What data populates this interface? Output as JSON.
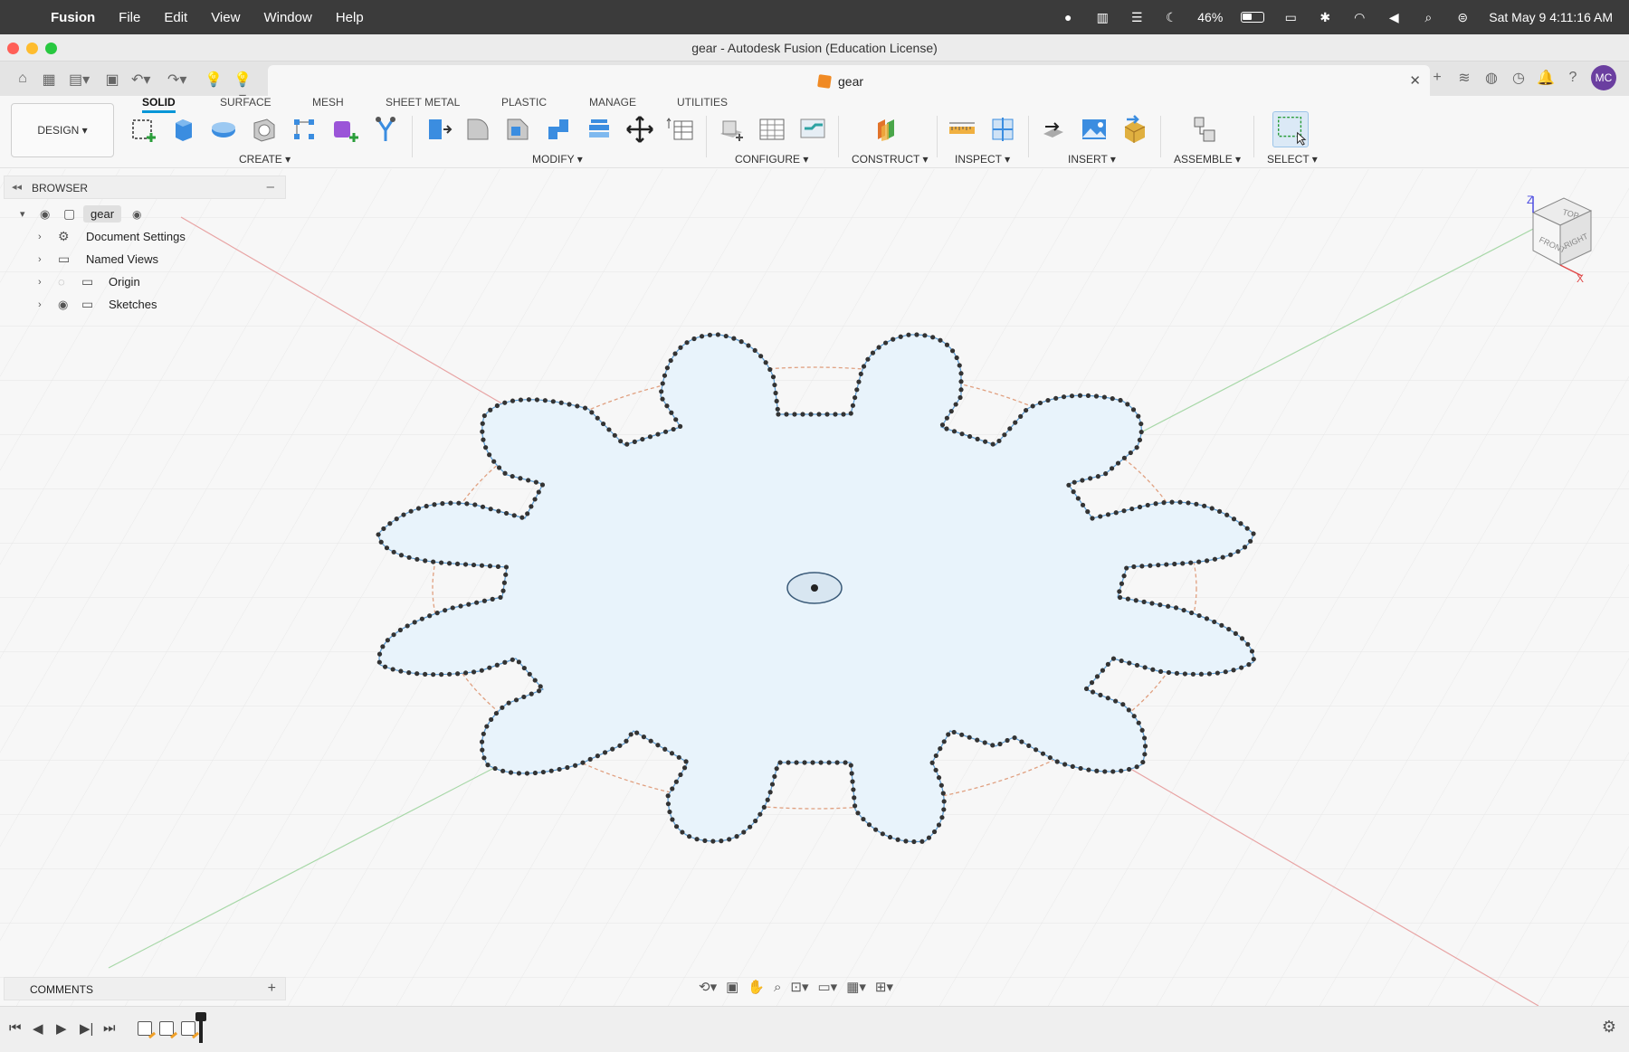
{
  "menubar": {
    "app_name": "Fusion",
    "menus": [
      "File",
      "Edit",
      "View",
      "Window",
      "Help"
    ],
    "battery": "46%",
    "datetime": "Sat May 9  4:11:16 AM"
  },
  "window": {
    "title": "gear - Autodesk Fusion (Education License)"
  },
  "tab": {
    "name": "gear"
  },
  "user": {
    "initials": "MC"
  },
  "toolbar": {
    "design_label": "DESIGN ▾",
    "tabs": [
      "SOLID",
      "SURFACE",
      "MESH",
      "SHEET METAL",
      "PLASTIC",
      "MANAGE",
      "UTILITIES"
    ],
    "groups": [
      "CREATE ▾",
      "MODIFY ▾",
      "CONFIGURE ▾",
      "CONSTRUCT ▾",
      "INSPECT ▾",
      "INSERT ▾",
      "ASSEMBLE ▾",
      "SELECT ▾"
    ]
  },
  "browser": {
    "title": "BROWSER",
    "root": "gear",
    "nodes": [
      "Document Settings",
      "Named Views",
      "Origin",
      "Sketches"
    ]
  },
  "comments": {
    "title": "COMMENTS"
  },
  "viewcube": {
    "top": "TOP",
    "front": "FRONT",
    "right": "RIGHT",
    "z": "Z",
    "x": "X"
  },
  "colors": {
    "accent": "#0696d7",
    "sketch_fill": "#e8f3fb",
    "sketch_dots": "#333333",
    "circle": "#e0a080"
  }
}
